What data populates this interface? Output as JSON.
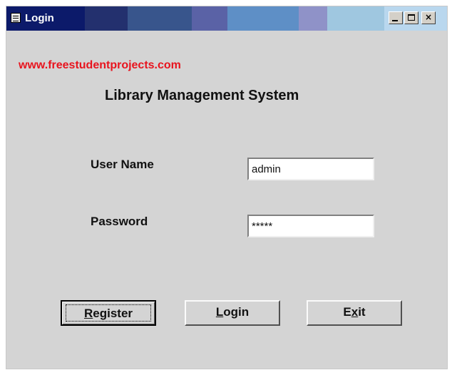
{
  "window": {
    "title": "Login",
    "controls": {
      "minimize": "minimize",
      "maximize": "maximize",
      "close": "×"
    }
  },
  "link_text": "www.freestudentprojects.com",
  "app_title": "Library Management System",
  "form": {
    "username_label": "User Name",
    "username_value": "admin",
    "password_label": "Password",
    "password_value": "*****"
  },
  "buttons": {
    "register": {
      "first": "R",
      "rest": "egister"
    },
    "login": {
      "first": "L",
      "rest": "ogin"
    },
    "exit": {
      "before": "E",
      "underlined": "x",
      "after": "it"
    }
  },
  "colors": {
    "link": "#e8141e",
    "window_bg": "#d4d4d4",
    "title_text": "#ffffff"
  }
}
